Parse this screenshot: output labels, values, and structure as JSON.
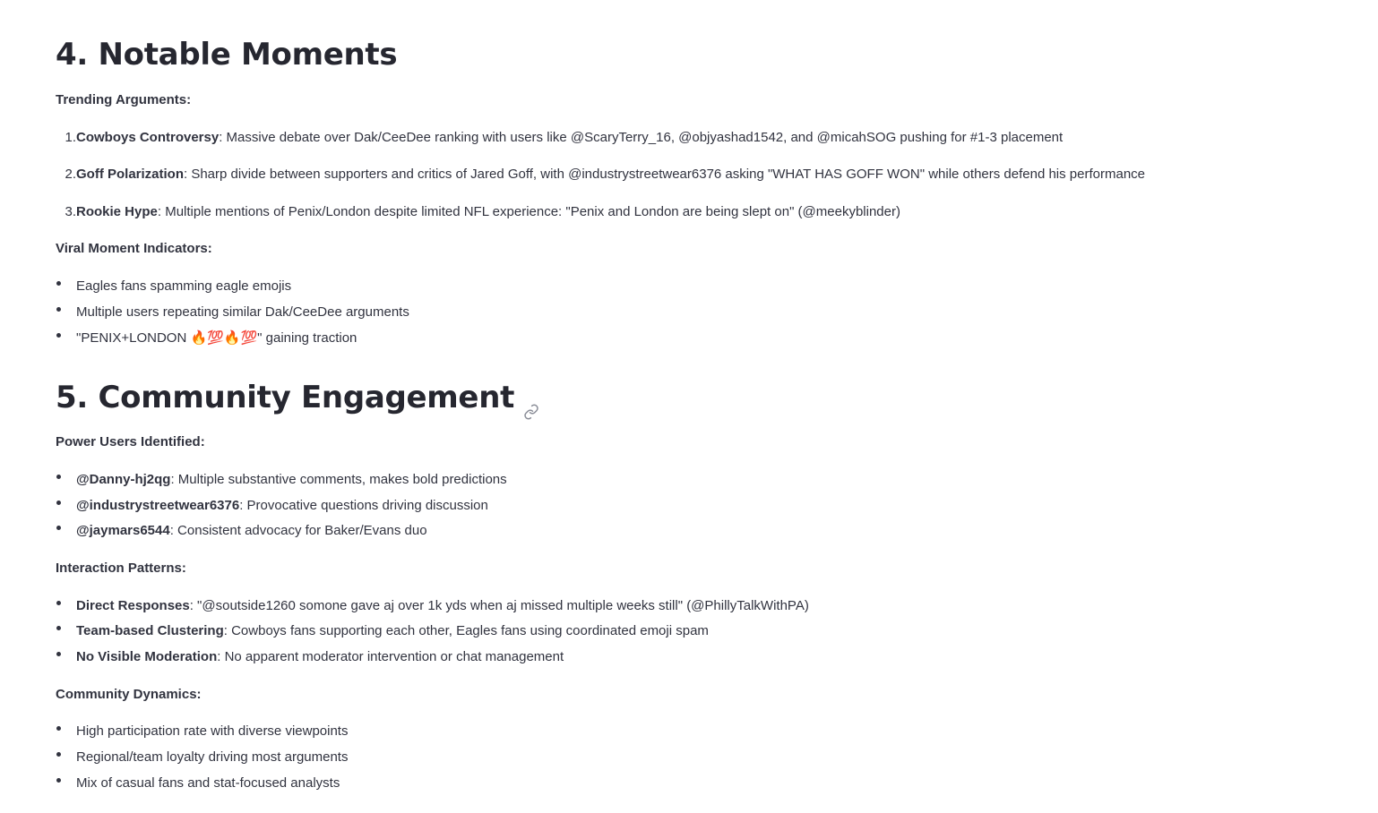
{
  "section4": {
    "heading": "4. Notable Moments",
    "trending_label": "Trending Arguments:",
    "trending": [
      {
        "num": "1.",
        "title": "Cowboys Controversy",
        "text": ": Massive debate over Dak/CeeDee ranking with users like @ScaryTerry_16, @objyashad1542, and @micahSOG pushing for #1-3 placement"
      },
      {
        "num": "2.",
        "title": "Goff Polarization",
        "text": ": Sharp divide between supporters and critics of Jared Goff, with @industrystreetwear6376 asking \"WHAT HAS GOFF WON\" while others defend his performance"
      },
      {
        "num": "3.",
        "title": "Rookie Hype",
        "text": ": Multiple mentions of Penix/London despite limited NFL experience: \"Penix and London are being slept on\" (@meekyblinder)"
      }
    ],
    "viral_label": "Viral Moment Indicators:",
    "viral": [
      "Eagles fans spamming eagle emojis",
      "Multiple users repeating similar Dak/CeeDee arguments",
      "\"PENIX+LONDON 🔥💯🔥💯\" gaining traction"
    ]
  },
  "section5": {
    "heading": "5. Community Engagement",
    "power_label": "Power Users Identified:",
    "power": [
      {
        "title": "@Danny-hj2qg",
        "text": ": Multiple substantive comments, makes bold predictions"
      },
      {
        "title": "@industrystreetwear6376",
        "text": ": Provocative questions driving discussion"
      },
      {
        "title": "@jaymars6544",
        "text": ": Consistent advocacy for Baker/Evans duo"
      }
    ],
    "interaction_label": "Interaction Patterns:",
    "interaction": [
      {
        "title": "Direct Responses",
        "text": ": \"@soutside1260 somone gave aj over 1k yds when aj missed multiple weeks still\" (@PhillyTalkWithPA)"
      },
      {
        "title": "Team-based Clustering",
        "text": ": Cowboys fans supporting each other, Eagles fans using coordinated emoji spam"
      },
      {
        "title": "No Visible Moderation",
        "text": ": No apparent moderator intervention or chat management"
      }
    ],
    "dynamics_label": "Community Dynamics:",
    "dynamics": [
      "High participation rate with diverse viewpoints",
      "Regional/team loyalty driving most arguments",
      "Mix of casual fans and stat-focused analysts"
    ]
  },
  "icons": {
    "heading_anchor": "link-icon"
  }
}
